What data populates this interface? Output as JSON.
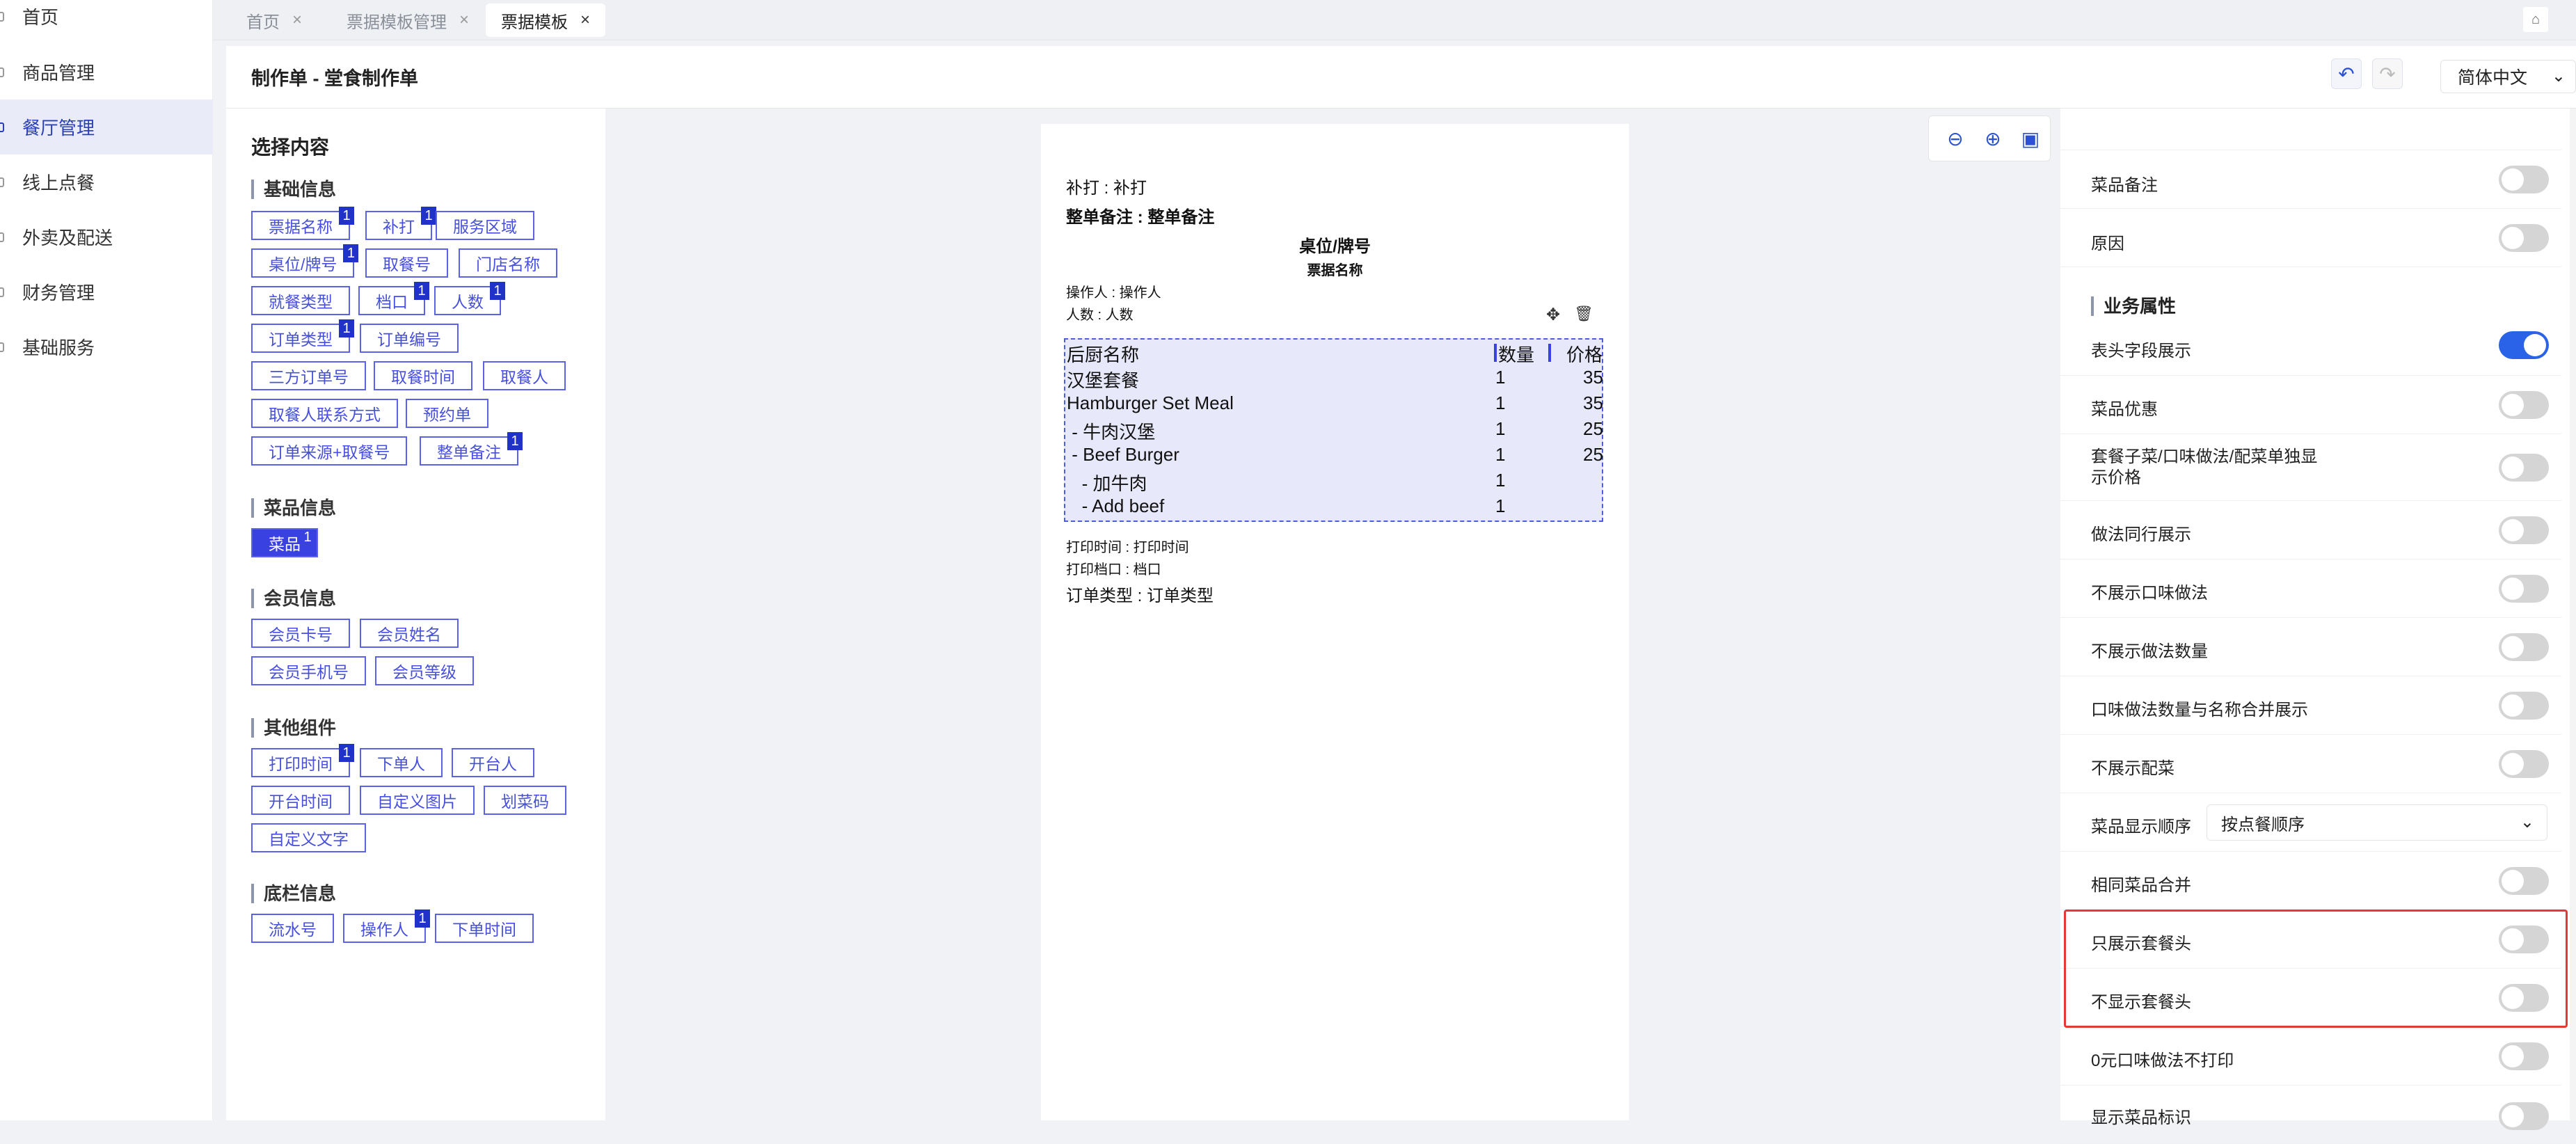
{
  "sidebar": {
    "items": [
      {
        "label": "首页"
      },
      {
        "label": "商品管理"
      },
      {
        "label": "餐厅管理",
        "active": true
      },
      {
        "label": "线上点餐"
      },
      {
        "label": "外卖及配送"
      },
      {
        "label": "财务管理"
      },
      {
        "label": "基础服务"
      }
    ]
  },
  "tabs": [
    {
      "label": "首页"
    },
    {
      "label": "票据模板管理"
    },
    {
      "label": "票据模板",
      "active": true
    }
  ],
  "tab_close": "×",
  "header": {
    "title": "制作单 - 堂食制作单",
    "undo": "↶",
    "redo": "↷",
    "language": "简体中文",
    "chevron": "⌄"
  },
  "left": {
    "title": "选择内容",
    "sections": [
      {
        "title": "基础信息",
        "items": [
          {
            "label": "票据名称",
            "badge": "1"
          },
          {
            "label": "补打",
            "badge": "1"
          },
          {
            "label": "服务区域"
          },
          {
            "label": "桌位/牌号",
            "badge": "1"
          },
          {
            "label": "取餐号"
          },
          {
            "label": "门店名称"
          },
          {
            "label": "就餐类型"
          },
          {
            "label": "档口",
            "badge": "1"
          },
          {
            "label": "人数",
            "badge": "1"
          },
          {
            "label": "订单类型",
            "badge": "1"
          },
          {
            "label": "订单编号"
          },
          {
            "label": "三方订单号"
          },
          {
            "label": "取餐时间"
          },
          {
            "label": "取餐人"
          },
          {
            "label": "取餐人联系方式"
          },
          {
            "label": "预约单"
          },
          {
            "label": "订单来源+取餐号"
          },
          {
            "label": "整单备注",
            "badge": "1"
          }
        ]
      },
      {
        "title": "菜品信息",
        "items": [
          {
            "label": "菜品",
            "badge": "1",
            "selected": true
          }
        ]
      },
      {
        "title": "会员信息",
        "items": [
          {
            "label": "会员卡号"
          },
          {
            "label": "会员姓名"
          },
          {
            "label": "会员手机号"
          },
          {
            "label": "会员等级"
          }
        ]
      },
      {
        "title": "其他组件",
        "items": [
          {
            "label": "打印时间",
            "badge": "1"
          },
          {
            "label": "下单人"
          },
          {
            "label": "开台人"
          },
          {
            "label": "开台时间"
          },
          {
            "label": "自定义图片"
          },
          {
            "label": "划菜码"
          },
          {
            "label": "自定义文字"
          }
        ]
      },
      {
        "title": "底栏信息",
        "items": [
          {
            "label": "流水号"
          },
          {
            "label": "操作人",
            "badge": "1"
          },
          {
            "label": "下单时间"
          }
        ]
      }
    ]
  },
  "zoom": {
    "out": "⊖",
    "in": "⊕",
    "fit": "▣"
  },
  "receipt": {
    "reprint": "补打 : 补打",
    "remark": "整单备注 : 整单备注",
    "table_no": "桌位/牌号",
    "ticket_name": "票据名称",
    "operator": "操作人 : 操作人",
    "people": "人数 : 人数",
    "move_icon": "✥",
    "delete_icon": "🗑",
    "columns": [
      "后厨名称",
      "数量",
      "价格"
    ],
    "rows": [
      {
        "name": "汉堡套餐",
        "qty": "1",
        "price": "35"
      },
      {
        "name": "Hamburger Set Meal",
        "qty": "1",
        "price": "35"
      },
      {
        "name": " - 牛肉汉堡",
        "qty": "1",
        "price": "25"
      },
      {
        "name": " - Beef Burger",
        "qty": "1",
        "price": "25"
      },
      {
        "name": "   - 加牛肉",
        "qty": "1",
        "price": ""
      },
      {
        "name": "   - Add beef",
        "qty": "1",
        "price": ""
      }
    ],
    "print_time": "打印时间 : 打印时间",
    "stall": "打印档口 : 档口",
    "order_type": "订单类型 : 订单类型"
  },
  "right": {
    "top_rows": [
      {
        "label": "菜品备注",
        "on": false
      },
      {
        "label": "原因",
        "on": false
      }
    ],
    "section": "业务属性",
    "rows": [
      {
        "label": "表头字段展示",
        "on": true
      },
      {
        "label": "菜品优惠",
        "on": false
      },
      {
        "label": "套餐子菜/口味做法/配菜单独显示价格",
        "on": false
      },
      {
        "label": "做法同行展示",
        "on": false
      },
      {
        "label": "不展示口味做法",
        "on": false
      },
      {
        "label": "不展示做法数量",
        "on": false
      },
      {
        "label": "口味做法数量与名称合并展示",
        "on": false
      },
      {
        "label": "不展示配菜",
        "on": false
      }
    ],
    "order_label": "菜品显示顺序",
    "order_value": "按点餐顺序",
    "rows2": [
      {
        "label": "相同菜品合并",
        "on": false
      },
      {
        "label": "只展示套餐头",
        "on": false
      },
      {
        "label": "不显示套餐头",
        "on": false
      },
      {
        "label": "0元口味做法不打印",
        "on": false
      },
      {
        "label": "显示菜品标识",
        "on": false
      }
    ]
  },
  "colors": {
    "accent": "#2b63e8",
    "chip": "#4750dc",
    "highlight": "#e53935"
  }
}
